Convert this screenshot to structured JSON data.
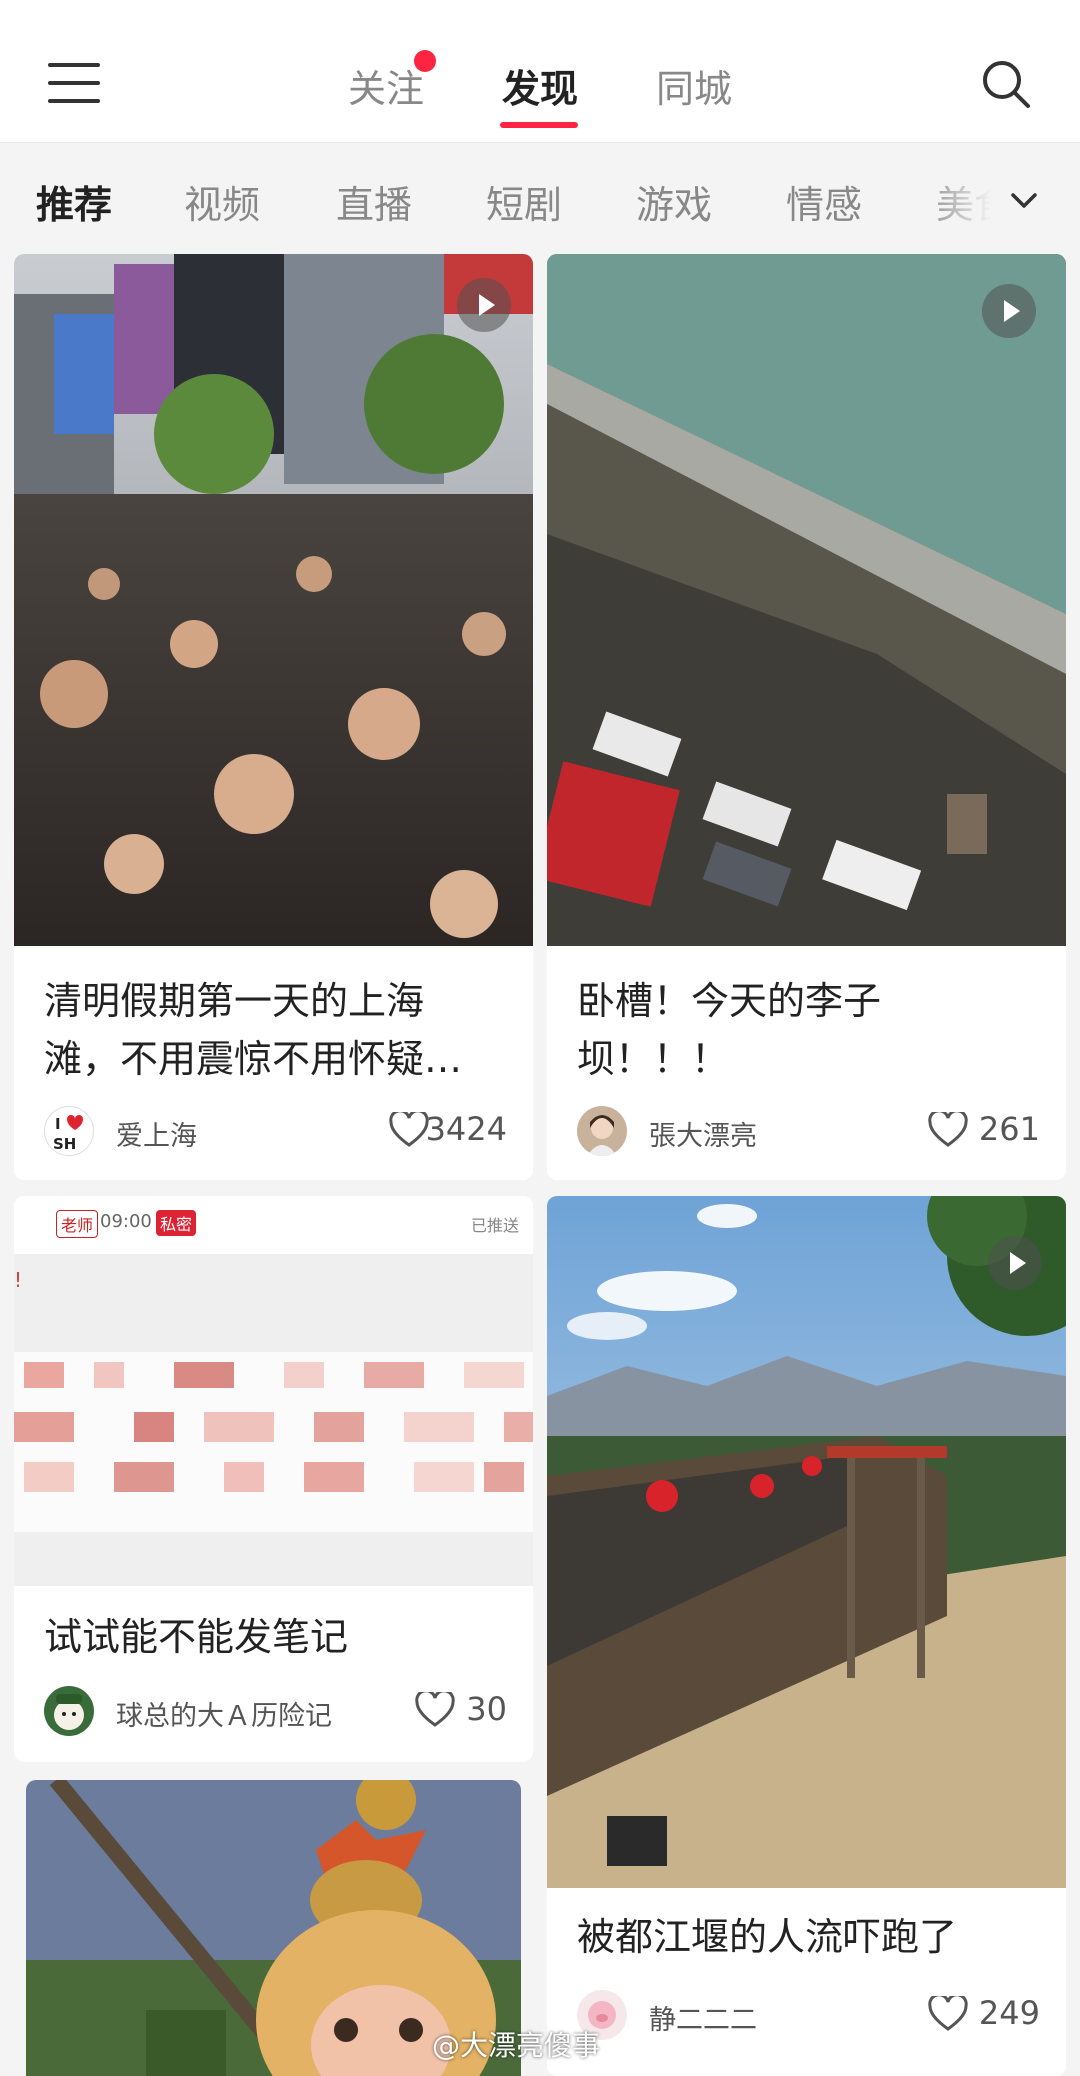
{
  "top_tabs": {
    "follow": "关注",
    "discover": "发现",
    "local": "同城"
  },
  "categories": [
    "推荐",
    "视频",
    "直播",
    "短剧",
    "游戏",
    "情感",
    "美食"
  ],
  "cards": [
    {
      "title_line1": "清明假期第一天的上海",
      "title_line2": "滩，不用震惊不用怀疑…",
      "author": "爱上海",
      "likes": "3424",
      "is_video": true,
      "avatar_text_1": "I",
      "avatar_text_2": "SH"
    },
    {
      "title_line1": "卧槽！今天的李子",
      "title_line2": "坝！！！",
      "author": "張大漂亮",
      "likes": "261",
      "is_video": true
    },
    {
      "title_line1": "试试能不能发笔记",
      "author": "球总的大Ａ历险记",
      "likes": "30",
      "is_video": false,
      "screenshot_tag1": "老师",
      "screenshot_time": "09:00",
      "screenshot_tag2": "私密",
      "screenshot_status": "已推送",
      "screenshot_mark": "!"
    },
    {
      "title_line1": "被都江堰的人流吓跑了",
      "author": "静二二二",
      "likes": "249",
      "is_video": true
    }
  ],
  "watermark": "@大漂亮傻事",
  "colors": {
    "accent": "#ff2442",
    "background": "#f4f4f4",
    "card": "#ffffff"
  },
  "icons": [
    "menu-icon",
    "search-icon",
    "chevron-down-icon",
    "play-icon",
    "heart-icon"
  ]
}
